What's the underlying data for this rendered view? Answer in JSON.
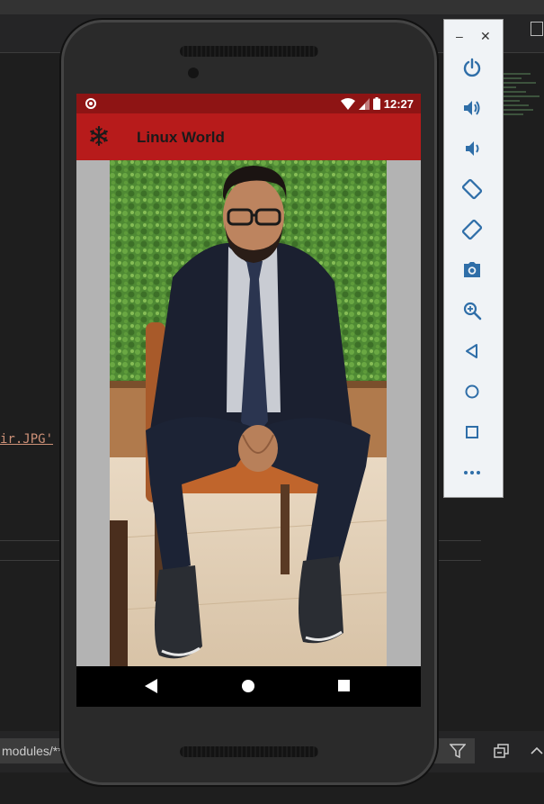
{
  "ide": {
    "code_fragment": "ir.JPG'",
    "filter_text": "modules/**"
  },
  "device": {
    "status_bar": {
      "time": "12:27"
    },
    "app_bar": {
      "title": "Linux World"
    },
    "photo": {
      "subject": "man in suit seated on chair"
    }
  },
  "emulator_panel": {
    "controls": [
      "power-icon",
      "volume-up-icon",
      "volume-down-icon",
      "rotate-left-icon",
      "rotate-right-icon",
      "camera-icon",
      "zoom-icon",
      "back-icon",
      "home-icon",
      "overview-icon",
      "more-icon"
    ]
  },
  "colors": {
    "status_bar": "#8e1414",
    "app_bar": "#b71b1b",
    "emulator_accent": "#2f6ea8"
  }
}
